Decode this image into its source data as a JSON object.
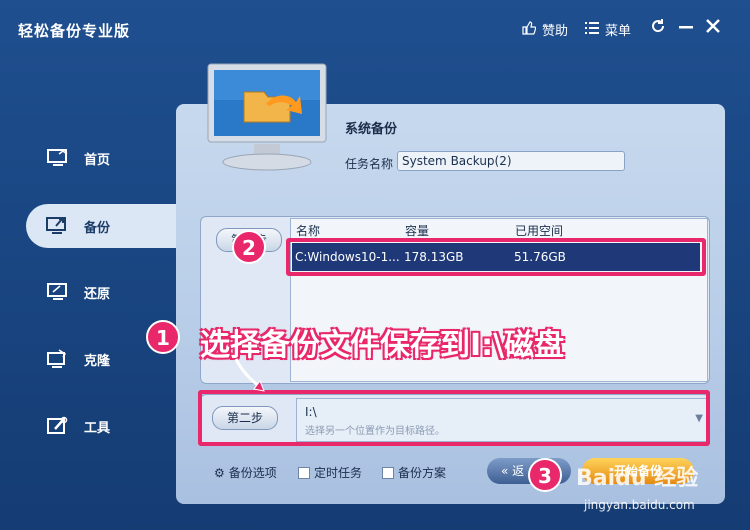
{
  "app": {
    "title": "轻松备份专业版",
    "sponsor_label": "赞助",
    "menu_label": "菜单"
  },
  "sidebar": {
    "items": [
      {
        "label": "首页",
        "icon": "home-monitor-icon"
      },
      {
        "label": "备份",
        "icon": "backup-monitor-icon"
      },
      {
        "label": "还原",
        "icon": "restore-monitor-icon"
      },
      {
        "label": "克隆",
        "icon": "clone-monitor-icon"
      },
      {
        "label": "工具",
        "icon": "tools-icon"
      }
    ]
  },
  "main": {
    "section_title": "系统备份",
    "task_name_label": "任务名称",
    "task_name_value": "System Backup(2)",
    "step1_label": "第一步",
    "step2_label": "第二步",
    "table": {
      "headers": [
        "名称",
        "容量",
        "已用空间"
      ],
      "rows": [
        {
          "name": "C:Windows10-1...",
          "capacity": "178.13GB",
          "used": "51.76GB"
        }
      ]
    },
    "destination_path": "I:\\",
    "destination_hint": "选择另一个位置作为目标路径。"
  },
  "bottom": {
    "backup_options": "备份选项",
    "scheduled_task": "定时任务",
    "backup_scheme": "备份方案",
    "back_button": "« 返",
    "start_button": "开始备份"
  },
  "annotations": {
    "instruction_text": "选择备份文件保存到I:\\磁盘",
    "badge1": "1",
    "badge2": "2",
    "badge3": "3",
    "highlight_color": "#e8286a"
  },
  "watermark": {
    "brand": "Baidu 经验",
    "url": "jingyan.baidu.com"
  }
}
